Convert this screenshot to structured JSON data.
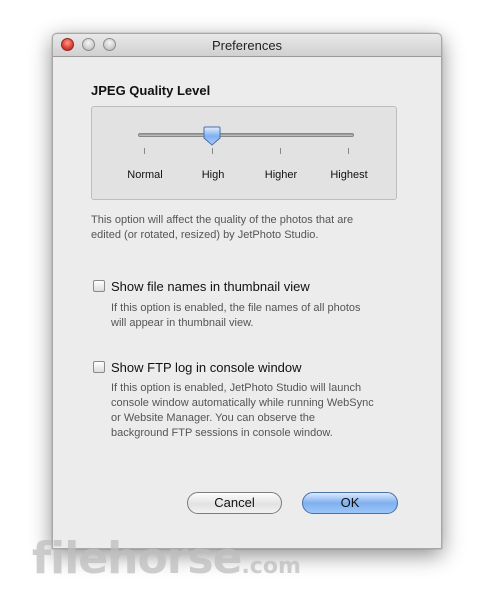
{
  "window": {
    "title": "Preferences"
  },
  "jpeg": {
    "heading": "JPEG Quality Level",
    "levels": [
      "Normal",
      "High",
      "Higher",
      "Highest"
    ],
    "selected": "High",
    "description_line1": "This option will affect the quality of the photos that are",
    "description_line2": "edited (or rotated, resized) by JetPhoto Studio."
  },
  "thumbnail_option": {
    "label": "Show file names in thumbnail view",
    "checked": false,
    "description_line1": "If this option is enabled, the file names of all photos",
    "description_line2": "will appear in thumbnail view."
  },
  "ftp_option": {
    "label": "Show FTP log in console window",
    "checked": false,
    "description_line1": "If this option is enabled,  JetPhoto Studio will launch",
    "description_line2": "console window automatically while running WebSync",
    "description_line3": "or Website Manager. You can observe the",
    "description_line4": "background FTP sessions in console window."
  },
  "buttons": {
    "cancel": "Cancel",
    "ok": "OK"
  },
  "watermark": {
    "name": "filehorse",
    "suffix": ".com"
  },
  "colors": {
    "default_button": "#7fb0ef",
    "close_button": "#e0443a"
  }
}
